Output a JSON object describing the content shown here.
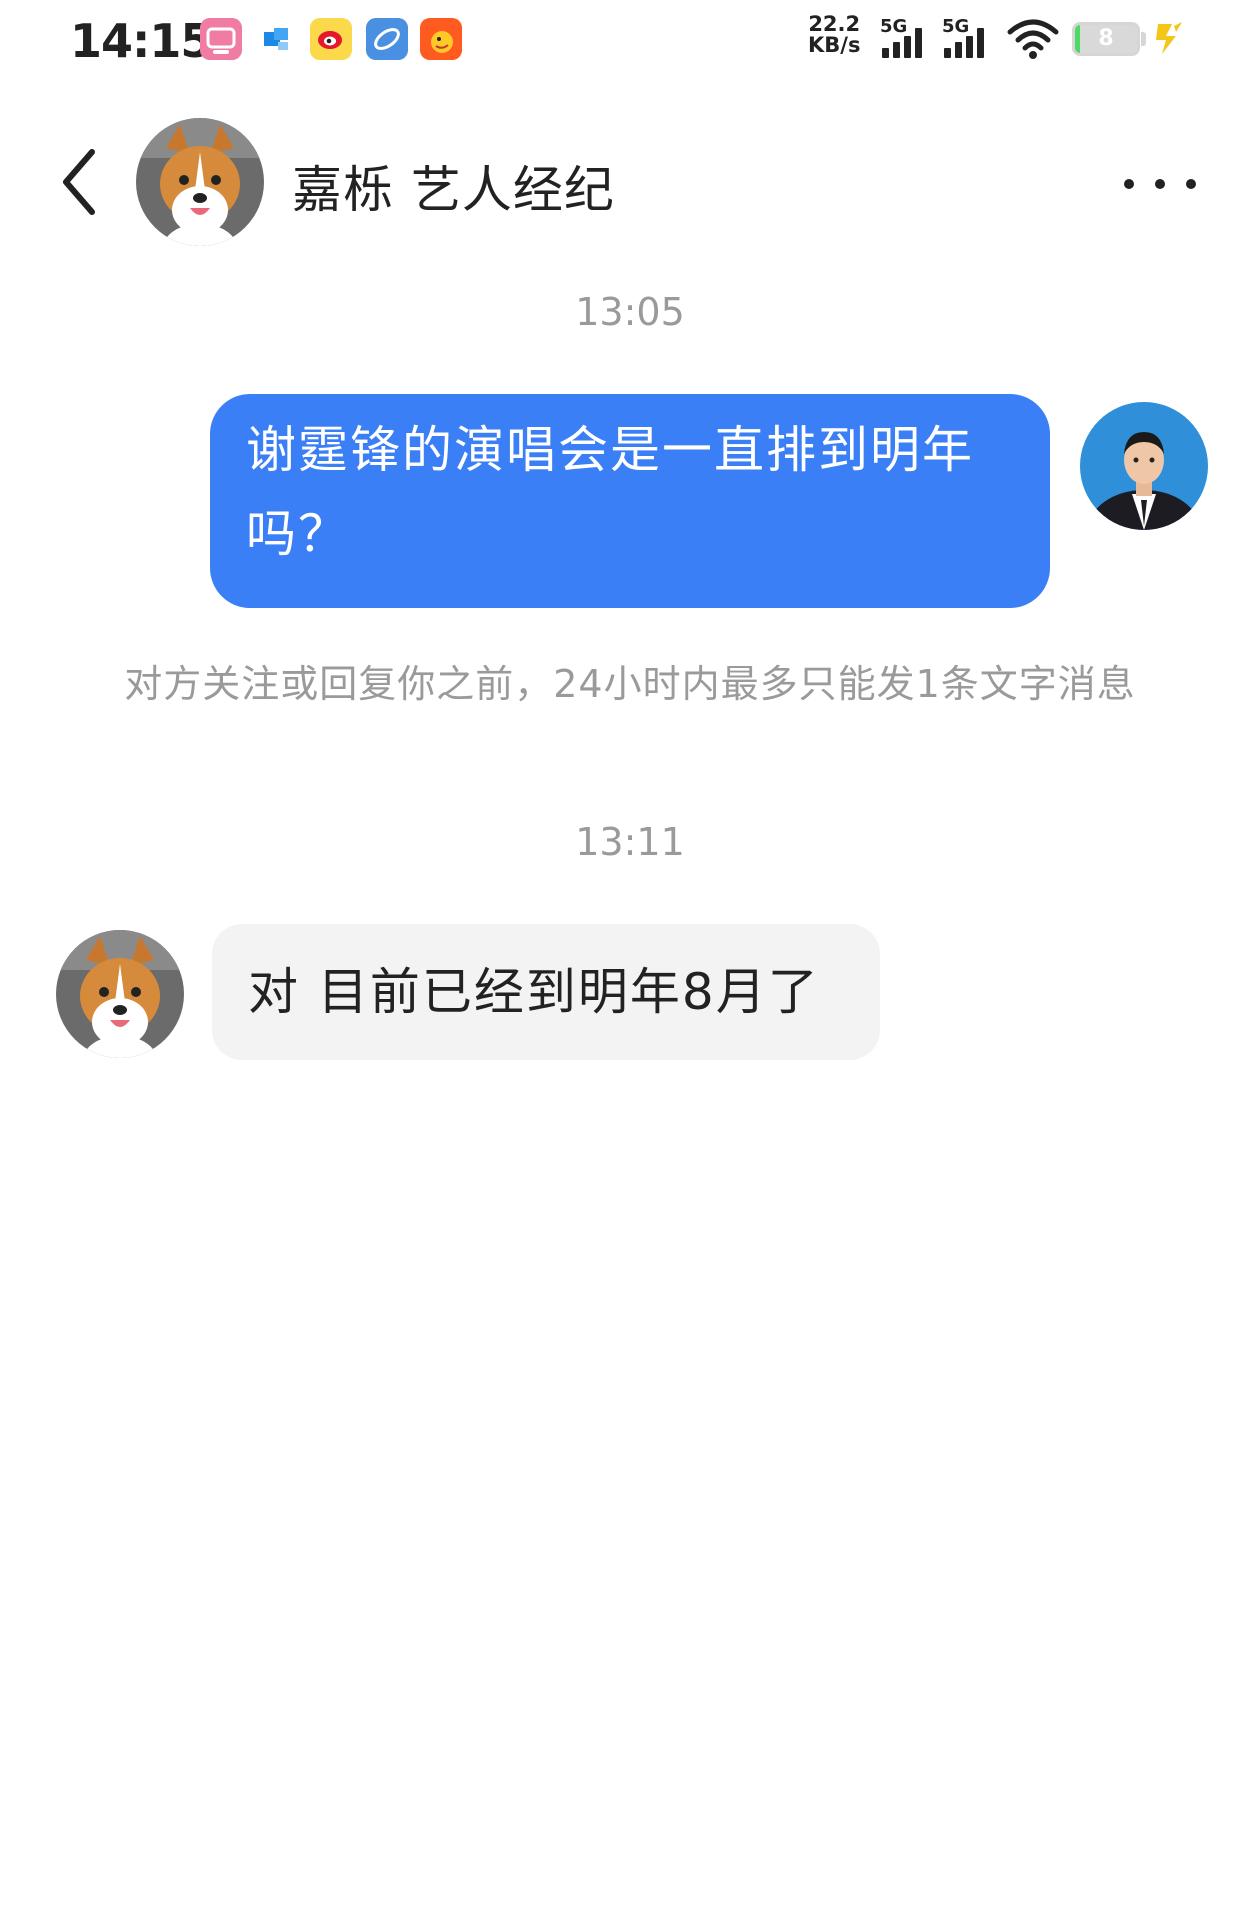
{
  "status_bar": {
    "time": "14:15",
    "app_icons": [
      "bilibili-app-icon",
      "blue-app-icon",
      "weibo-app-icon",
      "browser-app-icon",
      "taobao-app-icon"
    ],
    "net_speed_value": "22.2",
    "net_speed_unit": "KB/s",
    "signal_1_label": "5G",
    "signal_2_label": "5G",
    "battery_level": "8",
    "battery_fraction": 0.08
  },
  "header": {
    "title": "嘉栎 艺人经纪"
  },
  "chat": {
    "timestamp_1": "13:05",
    "sent_message": "谢霆锋的演唱会是一直排到明年吗？",
    "system_notice": "对方关注或回复你之前，24小时内最多只能发1条文字消息",
    "timestamp_2": "13:11",
    "received_message": "对 目前已经到明年8月了"
  },
  "colors": {
    "sent_bubble": "#3a7ff6",
    "received_bubble": "#f3f3f3",
    "muted_text": "#9a9a9a"
  }
}
